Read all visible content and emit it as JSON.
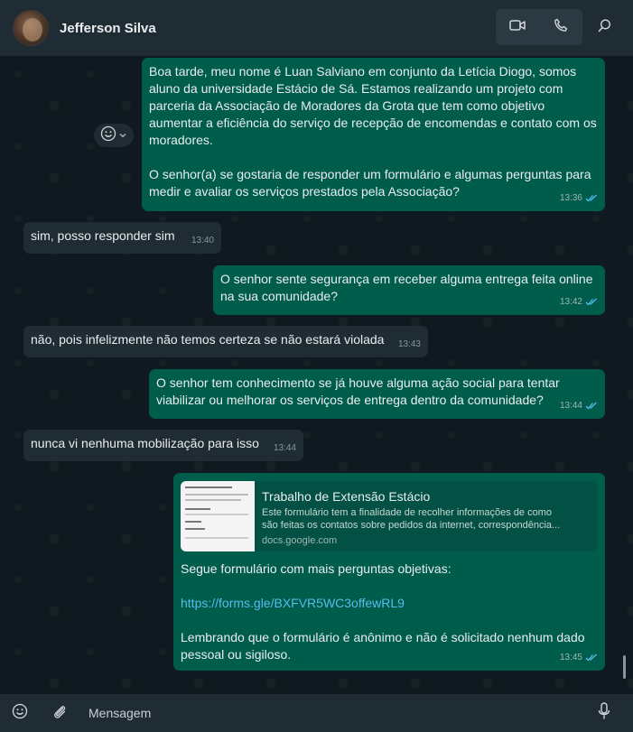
{
  "header": {
    "contact_name": "Jefferson Silva",
    "video_icon": "video-camera-icon",
    "call_icon": "phone-icon",
    "search_icon": "search-icon"
  },
  "messages": [
    {
      "direction": "outgoing",
      "text": "Boa tarde, meu nome é Luan Salviano em conjunto da Letícia Diogo, somos aluno da universidade Estácio de Sá. Estamos realizando um projeto com parceria da Associação de Moradores da Grota que tem como objetivo aumentar a eficiência do serviço de recepção de encomendas e contato com os moradores.\n\nO senhor(a) se gostaria de responder um formulário e algumas perguntas para medir e avaliar os serviços prestados pela Associação?",
      "time": "13:36",
      "status": "read"
    },
    {
      "direction": "incoming",
      "text": "sim, posso responder sim",
      "time": "13:40"
    },
    {
      "direction": "outgoing",
      "text": "O senhor sente segurança em receber alguma entrega feita online\nna sua comunidade?",
      "time": "13:42",
      "status": "read"
    },
    {
      "direction": "incoming",
      "text": "não, pois infelizmente não temos certeza se não estará violada",
      "time": "13:43"
    },
    {
      "direction": "outgoing",
      "text": "O senhor tem conhecimento se já houve alguma ação social para tentar\nviabilizar ou melhorar os serviços de entrega dentro da comunidade?",
      "time": "13:44",
      "status": "read"
    },
    {
      "direction": "incoming",
      "text": "nunca vi nenhuma mobilização para isso",
      "time": "13:44"
    },
    {
      "direction": "outgoing",
      "link_preview": {
        "title": "Trabalho de Extensão Estácio",
        "description_line1": "Este formulário tem a finalidade de recolher informações de como",
        "description_line2": "são feitas os contatos sobre pedidos da internet, correspondência...",
        "domain": "docs.google.com"
      },
      "text_before_link": "Segue formulário com mais perguntas objetivas:",
      "link": "https://forms.gle/BXFVR5WC3offewRL9",
      "text_after_link": "Lembrando que o formulário é anônimo e não é solicitado nenhum dado\npessoal ou sigiloso.",
      "time": "13:45",
      "status": "read"
    }
  ],
  "reaction_button": {
    "icon": "emoji-smile-icon",
    "chevron": "chevron-down-icon"
  },
  "composer": {
    "placeholder": "Mensagem",
    "emoji_icon": "emoji-icon",
    "attach_icon": "paperclip-icon",
    "mic_icon": "microphone-icon"
  },
  "colors": {
    "outgoing_bubble": "#005c4b",
    "incoming_bubble": "#202c33",
    "link": "#53bdeb",
    "read_tick": "#53bdeb"
  }
}
